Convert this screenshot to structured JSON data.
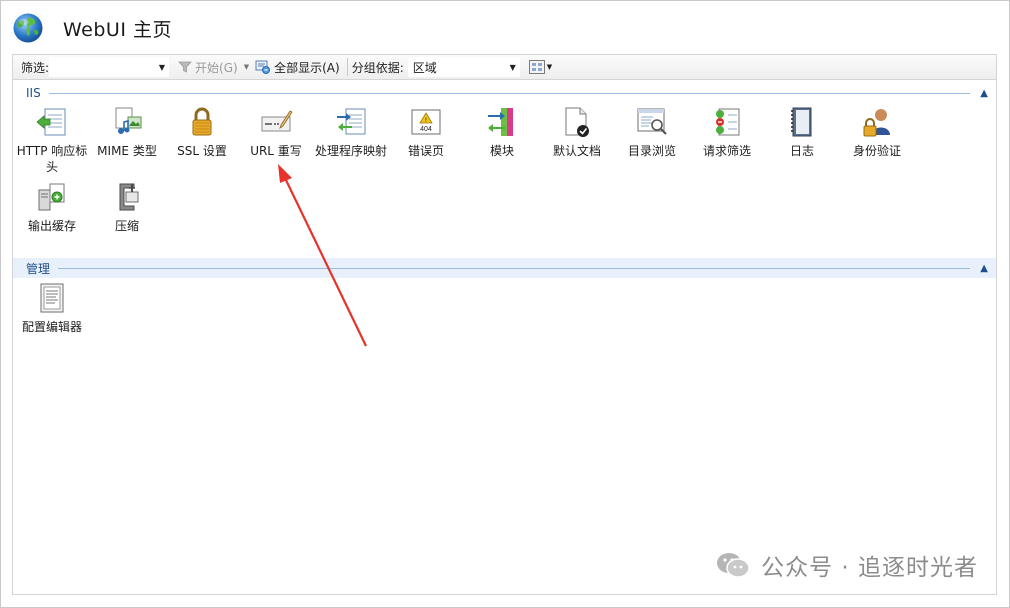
{
  "header": {
    "title": "WebUI 主页"
  },
  "toolbar": {
    "filter_label": "筛选:",
    "filter_value": "",
    "start_label": "开始(G)",
    "show_all_label": "全部显示(A)",
    "group_by_label": "分组依据:",
    "group_by_value": "区域"
  },
  "sections": {
    "iis": {
      "title": "IIS",
      "items": [
        {
          "label": "HTTP 响应标头",
          "icon": "http-response-headers-icon"
        },
        {
          "label": "MIME 类型",
          "icon": "mime-types-icon"
        },
        {
          "label": "SSL 设置",
          "icon": "ssl-lock-icon"
        },
        {
          "label": "URL 重写",
          "icon": "url-rewrite-icon"
        },
        {
          "label": "处理程序映射",
          "icon": "handler-mappings-icon"
        },
        {
          "label": "错误页",
          "icon": "error-pages-icon"
        },
        {
          "label": "模块",
          "icon": "modules-icon"
        },
        {
          "label": "默认文档",
          "icon": "default-document-icon"
        },
        {
          "label": "目录浏览",
          "icon": "directory-browsing-icon"
        },
        {
          "label": "请求筛选",
          "icon": "request-filtering-icon"
        },
        {
          "label": "日志",
          "icon": "logging-icon"
        },
        {
          "label": "身份验证",
          "icon": "authentication-icon"
        },
        {
          "label": "输出缓存",
          "icon": "output-caching-icon"
        },
        {
          "label": "压缩",
          "icon": "compression-icon"
        }
      ]
    },
    "management": {
      "title": "管理",
      "items": [
        {
          "label": "配置编辑器",
          "icon": "configuration-editor-icon"
        }
      ]
    }
  },
  "error_page_icon_text": "404",
  "watermark": {
    "text": "公众号 · 追逐时光者"
  },
  "colors": {
    "section_title": "#1f4e8c",
    "annotation_arrow": "#e8322c"
  }
}
